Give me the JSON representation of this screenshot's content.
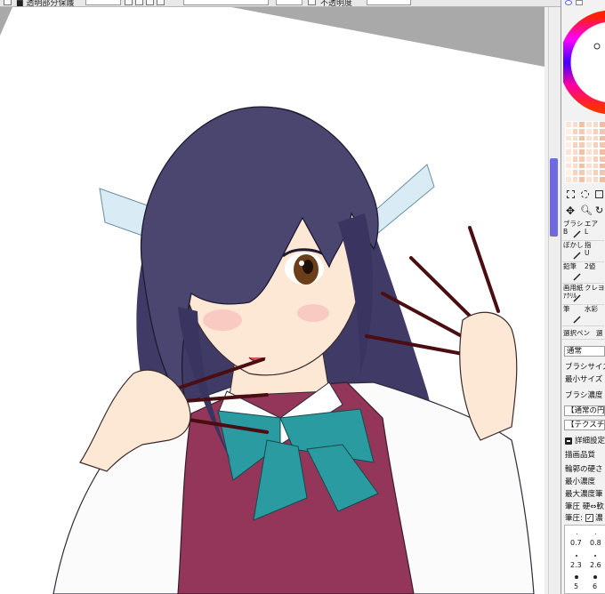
{
  "toolbar": {
    "partial_label": "■ 透明部分保護",
    "opacity_label": "不透明度"
  },
  "tools": {
    "brush": {
      "name": "ブラシ",
      "key": "B"
    },
    "eraser": {
      "name": "エア",
      "key": "L"
    },
    "blur": {
      "name": "ぼかし",
      "key": "-"
    },
    "finger": {
      "name": "指",
      "key": "U"
    },
    "pencil": {
      "name": "鉛筆",
      "key": ""
    },
    "binary": {
      "name": "2値",
      "key": ""
    },
    "paper": {
      "name": "画用紙",
      "key": "ｱｸﾘﾙ"
    },
    "crayon": {
      "name": "クレヨ",
      "key": ""
    },
    "pen": {
      "name": "筆",
      "key": ""
    },
    "watercolor": {
      "name": "水彩",
      "key": ""
    },
    "select_pen": {
      "name": "選択ペン",
      "key": "選"
    }
  },
  "brush_settings": {
    "blend_mode": "通常",
    "brush_size_label": "ブラシサイズ",
    "min_size_label": "最小サイズ",
    "density_label": "ブラシ濃度",
    "shape_select": "【通常の円形】",
    "texture_select": "【テクスチャなし】",
    "advanced_toggle": "詳細設定",
    "quality_label": "描画品質",
    "edge_hardness_label": "輪郭の硬さ",
    "min_density_label": "最小濃度",
    "max_density_label": "最大濃度筆",
    "pressure_label": "筆圧 硬⇔軟",
    "pressure_check_label": "筆圧:",
    "pressure_check_value": "濃"
  },
  "size_presets": [
    {
      "value": "0.7"
    },
    {
      "value": "0.8"
    },
    {
      "value": "2.3"
    },
    {
      "value": "2.6"
    },
    {
      "value": "5"
    },
    {
      "value": "6"
    }
  ],
  "colors": {
    "canvas_bg": "#a9a9a9",
    "paper": "#ffffff",
    "hair": "#4a4670",
    "vest": "#93365a",
    "bow": "#2a9ba0",
    "skin": "#fde8d6",
    "scroll_thumb": "#6f6adf"
  }
}
